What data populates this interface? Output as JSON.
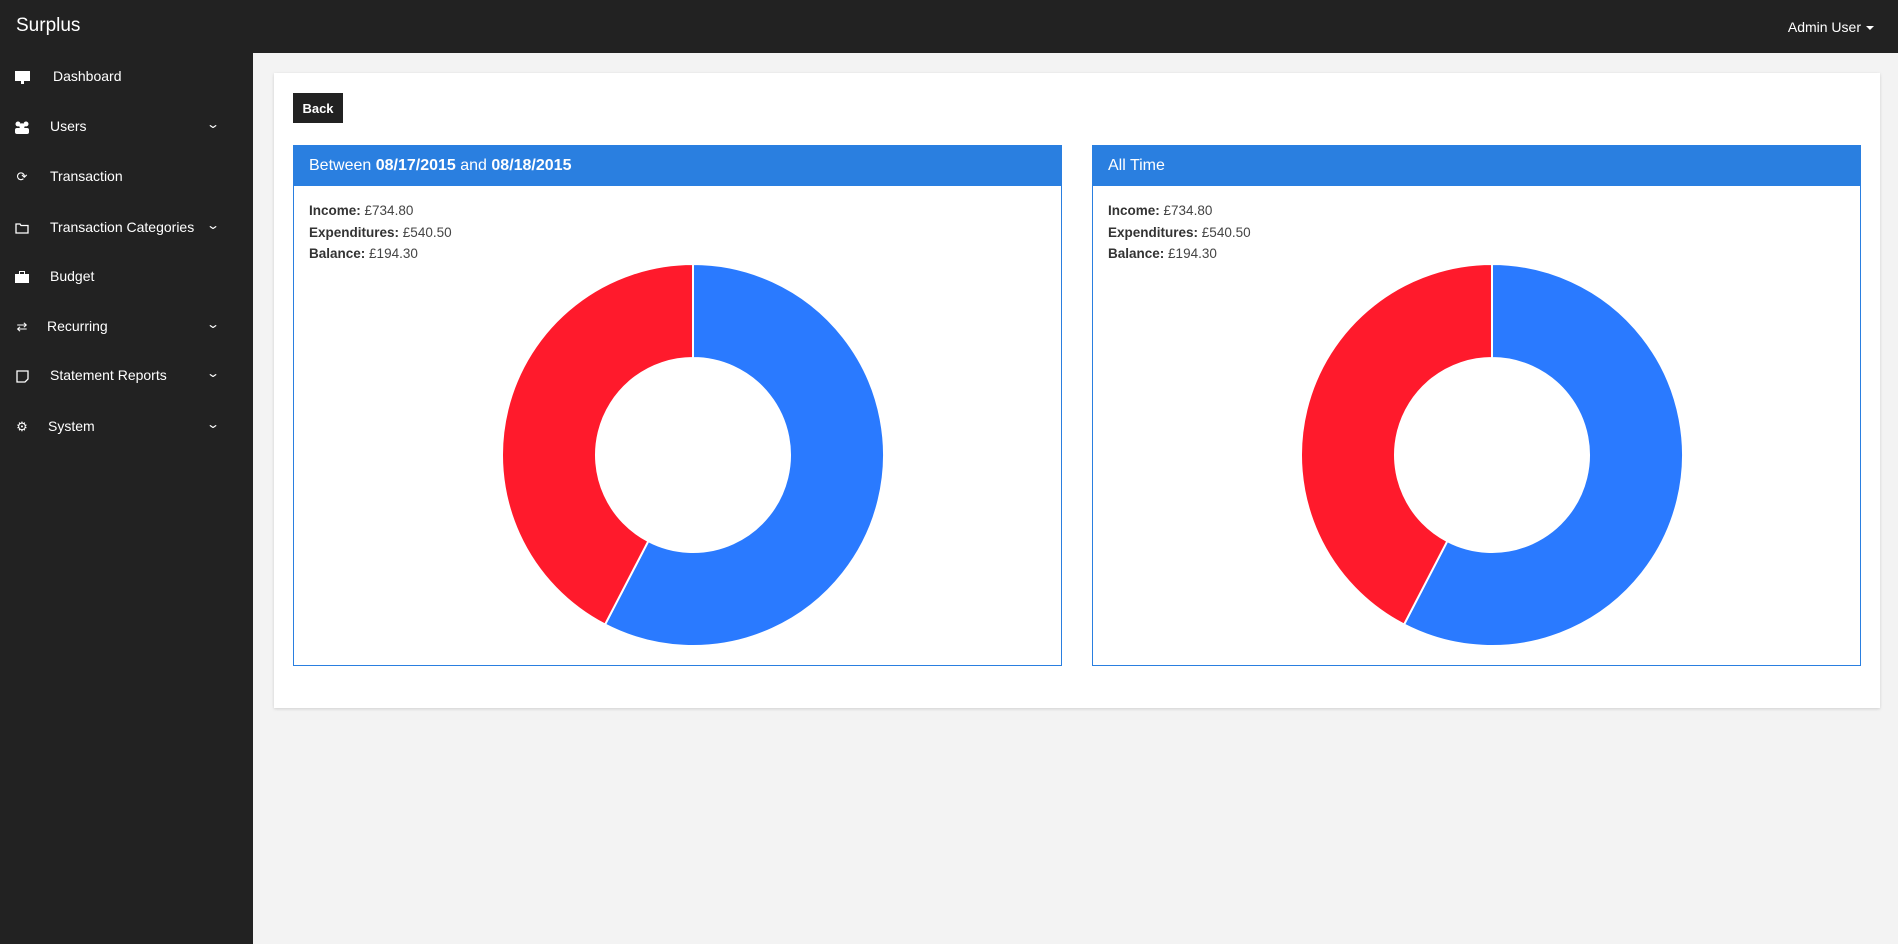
{
  "app": {
    "title": "Surplus",
    "user": "Admin User"
  },
  "sidebar": {
    "items": [
      {
        "label": "Dashboard",
        "icon": "monitor-icon",
        "sub": false
      },
      {
        "label": "Users",
        "icon": "users-icon",
        "sub": true
      },
      {
        "label": "Transaction",
        "icon": "refresh-icon",
        "sub": false
      },
      {
        "label": "Transaction Categories",
        "icon": "folder-icon",
        "sub": true
      },
      {
        "label": "Budget",
        "icon": "briefcase-icon",
        "sub": false
      },
      {
        "label": "Recurring",
        "icon": "exchange-icon",
        "sub": true
      },
      {
        "label": "Statement Reports",
        "icon": "note-icon",
        "sub": true
      },
      {
        "label": "System",
        "icon": "cogs-icon",
        "sub": true
      }
    ]
  },
  "main": {
    "back_label": "Back",
    "panels": [
      {
        "title_prefix": "Between ",
        "date_from": "08/17/2015",
        "title_mid": " and ",
        "date_to": "08/18/2015",
        "income_label": "Income:",
        "income": "£734.80",
        "exp_label": "Expenditures:",
        "exp": "£540.50",
        "bal_label": "Balance:",
        "bal": "£194.30"
      },
      {
        "title": "All Time",
        "income_label": "Income:",
        "income": "£734.80",
        "exp_label": "Expenditures:",
        "exp": "£540.50",
        "bal_label": "Balance:",
        "bal": "£194.30"
      }
    ]
  },
  "chart_data": [
    {
      "type": "pie",
      "variant": "doughnut",
      "categories": [
        "Income",
        "Expenditures"
      ],
      "values": [
        734.8,
        540.5
      ],
      "colors": [
        "#2a7aff",
        "#ff1a2c"
      ]
    },
    {
      "type": "pie",
      "variant": "doughnut",
      "categories": [
        "Income",
        "Expenditures"
      ],
      "values": [
        734.8,
        540.5
      ],
      "colors": [
        "#2a7aff",
        "#ff1a2c"
      ]
    }
  ]
}
